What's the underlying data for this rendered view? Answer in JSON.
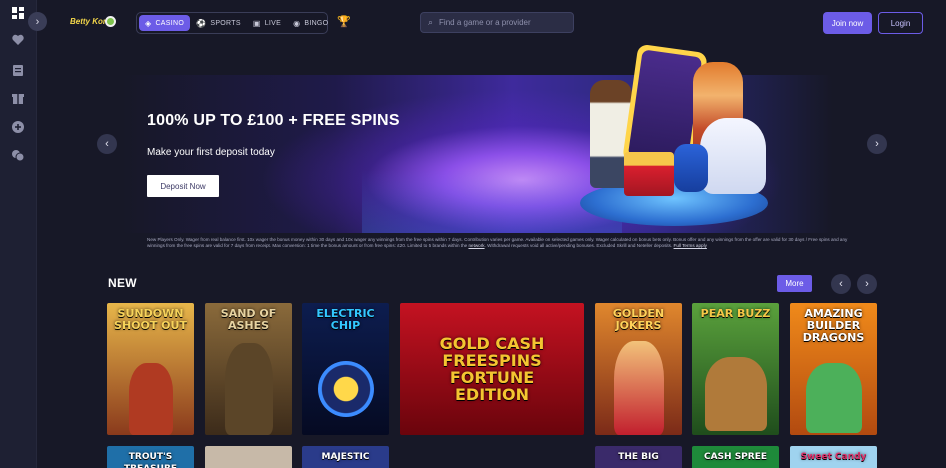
{
  "header": {
    "logo_text": "Betty Kong",
    "nav": [
      {
        "label": "CASINO",
        "icon": "casino-cube-icon",
        "active": true
      },
      {
        "label": "SPORTS",
        "icon": "soccer-ball-icon",
        "active": false
      },
      {
        "label": "LIVE",
        "icon": "live-tv-icon",
        "active": false
      },
      {
        "label": "BINGO",
        "icon": "bingo-ball-icon",
        "active": false
      }
    ],
    "search_placeholder": "Find a game or a provider",
    "join_label": "Join now",
    "login_label": "Login"
  },
  "sidebar": {
    "icons": [
      "dashboard-icon",
      "heart-icon",
      "calendar-list-icon",
      "gift-icon",
      "plus-circle-icon",
      "chips-icon"
    ]
  },
  "hero": {
    "title": "100% UP TO £100 + FREE SPINS",
    "subtitle": "Make your first deposit today",
    "cta_label": "Deposit Now",
    "terms": "New Players Only. Wager from real balance first. 10x wager the bonus money within 30 days and 10x wager any winnings from the free spins within 7 days. Contribution varies per game. Available on selected games only. Wager calculated on bonus bets only. Bonus offer and any winnings from the offer are valid for 30 days / Free spins and any winnings from the free spins are valid for 7 days from receipt. Max conversion: 1 time the bonus amount or from free spins: £20. Limited to 5 brands within the",
    "terms_link": "network",
    "terms_tail": ". Withdrawal requests void all active/pending bonuses. Excluded Skrill and Neteller deposits.",
    "terms_link2": "Full Terms apply"
  },
  "new_section": {
    "title": "NEW",
    "more_label": "More",
    "games": [
      {
        "title": "SUNDOWN SHOOT OUT",
        "bg1": "#e7b64a",
        "bg2": "#8a3a1c",
        "text_color": "#f7d35a"
      },
      {
        "title": "SAND OF ASHES",
        "bg1": "#8a6a3b",
        "bg2": "#3c2b1a",
        "text_color": "#e6d2a0"
      },
      {
        "title": "ELECTRIC CHIP",
        "bg1": "#0d1d4f",
        "bg2": "#050a22",
        "text_color": "#33c8ff"
      },
      {
        "title": "GOLD CASH FREESPINS FORTUNE EDITION",
        "bg1": "#c41221",
        "bg2": "#6a040c",
        "text_color": "#f4c531"
      },
      {
        "title": "GOLDEN JOKERS",
        "bg1": "#e0872d",
        "bg2": "#7b2a18",
        "text_color": "#ffd25a"
      },
      {
        "title": "PEAR BUZZ",
        "bg1": "#5aa13c",
        "bg2": "#1f4d1c",
        "text_color": "#f6c847"
      },
      {
        "title": "AMAZING BUILDER DRAGONS",
        "bg1": "#f08a1a",
        "bg2": "#b24a10",
        "text_color": "#ffffff"
      }
    ],
    "second_row": [
      {
        "title": "TROUT'S TREASURE",
        "bg": "#1f6fa8"
      },
      {
        "title": "",
        "bg": "#c7b9a8"
      },
      {
        "title": "MAJESTIC",
        "bg": "#2a3b8a"
      },
      {
        "title": "THE BIG",
        "bg": "#3a2a6a"
      },
      {
        "title": "CASH SPREE",
        "bg": "#1e8a3a"
      },
      {
        "title": "Sweet Candy",
        "bg": "#9fd3ef"
      }
    ]
  },
  "colors": {
    "accent": "#6c5ce7",
    "background": "#171827",
    "sidebar": "#1e2033"
  }
}
